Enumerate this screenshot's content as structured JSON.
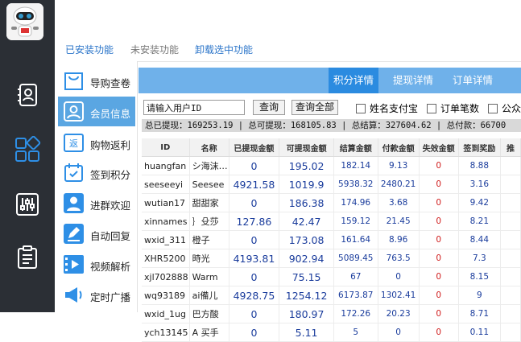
{
  "func_tabs": {
    "installed": "已安装功能",
    "not_installed": "未安装功能",
    "uninstall": "卸载选中功能"
  },
  "nav": [
    {
      "label": "导购查卷",
      "icon": "shopping-bag-icon"
    },
    {
      "label": "会员信息",
      "icon": "member-icon"
    },
    {
      "label": "购物返利",
      "icon": "rebate-icon"
    },
    {
      "label": "签到积分",
      "icon": "calendar-check-icon"
    },
    {
      "label": "进群欢迎",
      "icon": "group-welcome-icon"
    },
    {
      "label": "自动回复",
      "icon": "auto-reply-icon"
    },
    {
      "label": "视频解析",
      "icon": "video-icon"
    },
    {
      "label": "定时广播",
      "icon": "broadcast-icon"
    }
  ],
  "rail_icons": [
    "contacts-icon",
    "grid-apps-icon",
    "sliders-icon",
    "clipboard-icon"
  ],
  "subtabs": [
    "积分详情",
    "提现详情",
    "订单详情"
  ],
  "search": {
    "placeholder": "请输入用户ID",
    "query_btn": "查询",
    "query_all_btn": "查询全部"
  },
  "checkboxes": [
    "姓名支付宝",
    "订单笔数",
    "公众号"
  ],
  "summary": "总已提现：169253.19 | 总可提现：168105.83 | 总结算：327604.62 | 总付款：66700",
  "table": {
    "headers": [
      "ID",
      "名称",
      "已提现金额",
      "可提现金额",
      "结算金额",
      "付款金额",
      "失效金额",
      "签到奖励",
      "推"
    ],
    "rows": [
      [
        "huangfan",
        "シ海沫…",
        "0",
        "195.02",
        "182.14",
        "9.13",
        "0",
        "8.88",
        ""
      ],
      [
        "seeseeyi",
        "Seesee",
        "4921.58",
        "1019.9",
        "5938.32",
        "2480.21",
        "0",
        "3.16",
        ""
      ],
      [
        "wutian17",
        "甜甜家",
        "0",
        "186.38",
        "174.96",
        "3.68",
        "0",
        "9.42",
        ""
      ],
      [
        "xinnames",
        "｝殳莎",
        "127.86",
        "42.47",
        "159.12",
        "21.45",
        "0",
        "8.21",
        ""
      ],
      [
        "wxid_311",
        "橙子",
        "0",
        "173.08",
        "161.64",
        "8.96",
        "0",
        "8.44",
        ""
      ],
      [
        "XHR5200",
        "時光",
        "4193.81",
        "902.94",
        "5089.45",
        "763.5",
        "0",
        "7.3",
        ""
      ],
      [
        "xjl702888",
        "Warm",
        "0",
        "75.15",
        "67",
        "0",
        "0",
        "8.15",
        ""
      ],
      [
        "wq93189",
        "ai備儿",
        "4928.75",
        "1254.12",
        "6173.87",
        "1302.41",
        "0",
        "9",
        ""
      ],
      [
        "wxid_1ug",
        "巴方酸",
        "0",
        "180.97",
        "172.26",
        "20.23",
        "0",
        "8.71",
        ""
      ],
      [
        "ych13145",
        "A 买手",
        "0",
        "5.11",
        "5",
        "0",
        "0",
        "0.11",
        ""
      ]
    ]
  }
}
